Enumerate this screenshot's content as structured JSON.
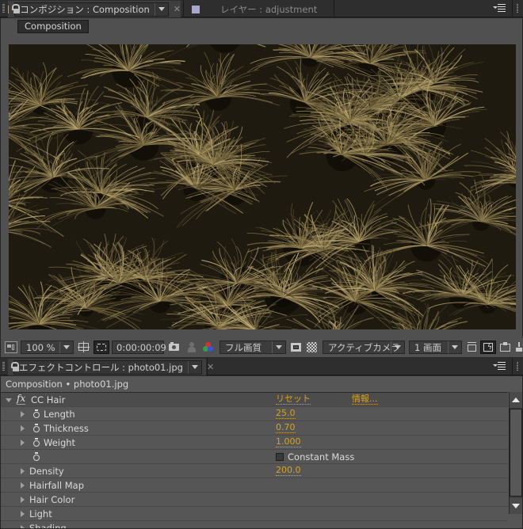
{
  "comp_tabbar": {
    "active_tab": {
      "label": "コンポジション : Composition",
      "swatch_color": "#b5a27c"
    },
    "inactive_tab": {
      "label": "レイヤー : adjustment",
      "swatch_color": "#a8a6cc"
    }
  },
  "comp_panel": {
    "breadcrumb": "Composition",
    "toolbar": {
      "magnification": "100 %",
      "timecode": "0:00:00:09",
      "resolution": "フル画質",
      "view": "アクティブカメラ",
      "layout": "1 画面"
    }
  },
  "fx_tabbar": {
    "active_tab": {
      "label": "エフェクトコントロール : photo01.jpg",
      "swatch_color": "#b0aee0"
    }
  },
  "fx_panel": {
    "breadcrumb": "Composition • photo01.jpg",
    "effect": {
      "name": "CC Hair",
      "reset_label": "リセット",
      "about_label": "情報...",
      "badge": "fx"
    },
    "params": [
      {
        "name": "Length",
        "value": "25.0"
      },
      {
        "name": "Thickness",
        "value": "0.70"
      },
      {
        "name": "Weight",
        "value": "1.000"
      }
    ],
    "constant_mass": {
      "label": "Constant Mass",
      "checked": false
    },
    "groups": [
      {
        "name": "Density",
        "value": "200.0"
      },
      {
        "name": "Hairfall Map"
      },
      {
        "name": "Hair Color"
      },
      {
        "name": "Light"
      },
      {
        "name": "Shading"
      }
    ]
  }
}
